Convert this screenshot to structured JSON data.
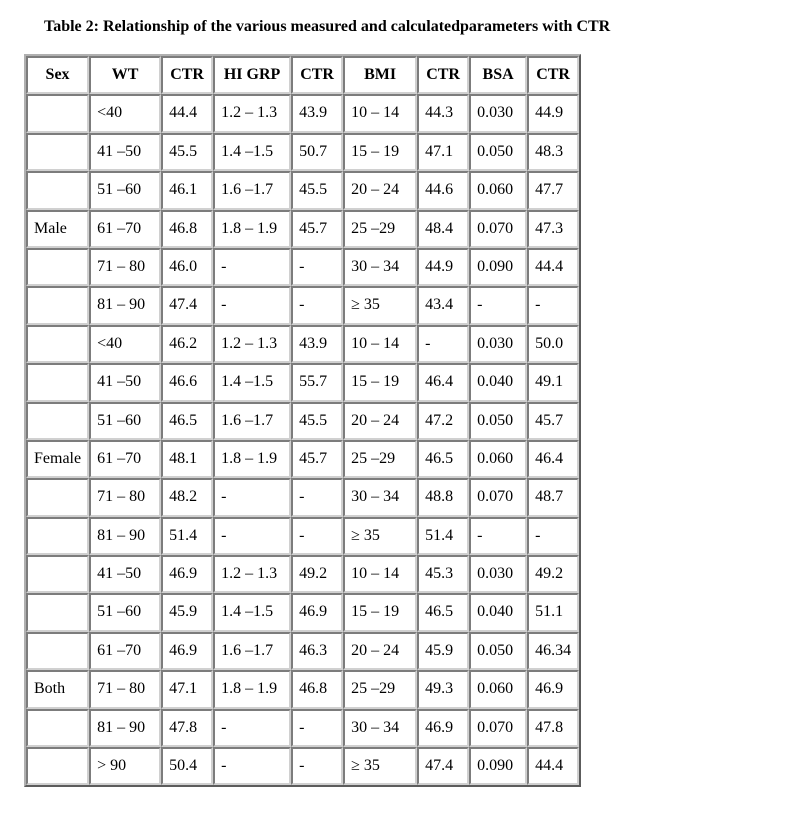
{
  "title": "Table 2: Relationship of the various measured and calculatedparameters with CTR",
  "headers": [
    "Sex",
    "WT",
    "CTR",
    "HI GRP",
    "CTR",
    "BMI",
    "CTR",
    "BSA",
    "CTR"
  ],
  "rows": [
    {
      "sex": "",
      "wt": "<40",
      "ctr1": "44.4",
      "hi": "1.2 – 1.3",
      "ctr2": "43.9",
      "bmi": "10 – 14",
      "ctr3": "44.3",
      "bsa": "0.030",
      "ctr4": "44.9"
    },
    {
      "sex": "",
      "wt": "41 –50",
      "ctr1": "45.5",
      "hi": "1.4 –1.5",
      "ctr2": "50.7",
      "bmi": "15 – 19",
      "ctr3": "47.1",
      "bsa": "0.050",
      "ctr4": "48.3"
    },
    {
      "sex": "",
      "wt": "51 –60",
      "ctr1": "46.1",
      "hi": "1.6 –1.7",
      "ctr2": "45.5",
      "bmi": "20 – 24",
      "ctr3": "44.6",
      "bsa": "0.060",
      "ctr4": "47.7"
    },
    {
      "sex": "Male",
      "wt": "61 –70",
      "ctr1": "46.8",
      "hi": "1.8 – 1.9",
      "ctr2": "45.7",
      "bmi": "25 –29",
      "ctr3": "48.4",
      "bsa": "0.070",
      "ctr4": "47.3"
    },
    {
      "sex": "",
      "wt": "71 – 80",
      "ctr1": "46.0",
      "hi": "-",
      "ctr2": "-",
      "bmi": "30 – 34",
      "ctr3": "44.9",
      "bsa": "0.090",
      "ctr4": "44.4"
    },
    {
      "sex": "",
      "wt": "81 – 90",
      "ctr1": "47.4",
      "hi": "-",
      "ctr2": "-",
      "bmi": "≥ 35",
      "ctr3": "43.4",
      "bsa": "-",
      "ctr4": "-"
    },
    {
      "sex": "",
      "wt": "<40",
      "ctr1": "46.2",
      "hi": "1.2 – 1.3",
      "ctr2": "43.9",
      "bmi": "10 – 14",
      "ctr3": "-",
      "bsa": "0.030",
      "ctr4": "50.0"
    },
    {
      "sex": "",
      "wt": "41 –50",
      "ctr1": "46.6",
      "hi": "1.4 –1.5",
      "ctr2": "55.7",
      "bmi": "15 – 19",
      "ctr3": "46.4",
      "bsa": "0.040",
      "ctr4": "49.1"
    },
    {
      "sex": "",
      "wt": "51 –60",
      "ctr1": "46.5",
      "hi": "1.6 –1.7",
      "ctr2": "45.5",
      "bmi": "20 – 24",
      "ctr3": "47.2",
      "bsa": "0.050",
      "ctr4": "45.7"
    },
    {
      "sex": "Female",
      "wt": "61 –70",
      "ctr1": "48.1",
      "hi": "1.8 – 1.9",
      "ctr2": "45.7",
      "bmi": "25 –29",
      "ctr3": "46.5",
      "bsa": "0.060",
      "ctr4": "46.4"
    },
    {
      "sex": "",
      "wt": "71 – 80",
      "ctr1": "48.2",
      "hi": "-",
      "ctr2": "-",
      "bmi": "30 – 34",
      "ctr3": "48.8",
      "bsa": "0.070",
      "ctr4": "48.7"
    },
    {
      "sex": "",
      "wt": "81 – 90",
      "ctr1": "51.4",
      "hi": "-",
      "ctr2": "-",
      "bmi": "≥ 35",
      "ctr3": "51.4",
      "bsa": "-",
      "ctr4": "-"
    },
    {
      "sex": "",
      "wt": "41 –50",
      "ctr1": "46.9",
      "hi": "1.2 – 1.3",
      "ctr2": "49.2",
      "bmi": "10 – 14",
      "ctr3": "45.3",
      "bsa": "0.030",
      "ctr4": "49.2"
    },
    {
      "sex": "",
      "wt": "51 –60",
      "ctr1": "45.9",
      "hi": "1.4 –1.5",
      "ctr2": "46.9",
      "bmi": "15 – 19",
      "ctr3": "46.5",
      "bsa": "0.040",
      "ctr4": "51.1"
    },
    {
      "sex": "",
      "wt": "61 –70",
      "ctr1": "46.9",
      "hi": "1.6 –1.7",
      "ctr2": "46.3",
      "bmi": "20 – 24",
      "ctr3": "45.9",
      "bsa": "0.050",
      "ctr4": "46.34"
    },
    {
      "sex": "Both",
      "wt": "71 – 80",
      "ctr1": "47.1",
      "hi": "1.8 – 1.9",
      "ctr2": "46.8",
      "bmi": "25 –29",
      "ctr3": "49.3",
      "bsa": "0.060",
      "ctr4": "46.9"
    },
    {
      "sex": "",
      "wt": "81 – 90",
      "ctr1": "47.8",
      "hi": "-",
      "ctr2": "-",
      "bmi": "30 – 34",
      "ctr3": "46.9",
      "bsa": "0.070",
      "ctr4": "47.8"
    },
    {
      "sex": "",
      "wt": "> 90",
      "ctr1": "50.4",
      "hi": "-",
      "ctr2": "-",
      "bmi": "≥ 35",
      "ctr3": "47.4",
      "bsa": "0.090",
      "ctr4": "44.4"
    }
  ]
}
